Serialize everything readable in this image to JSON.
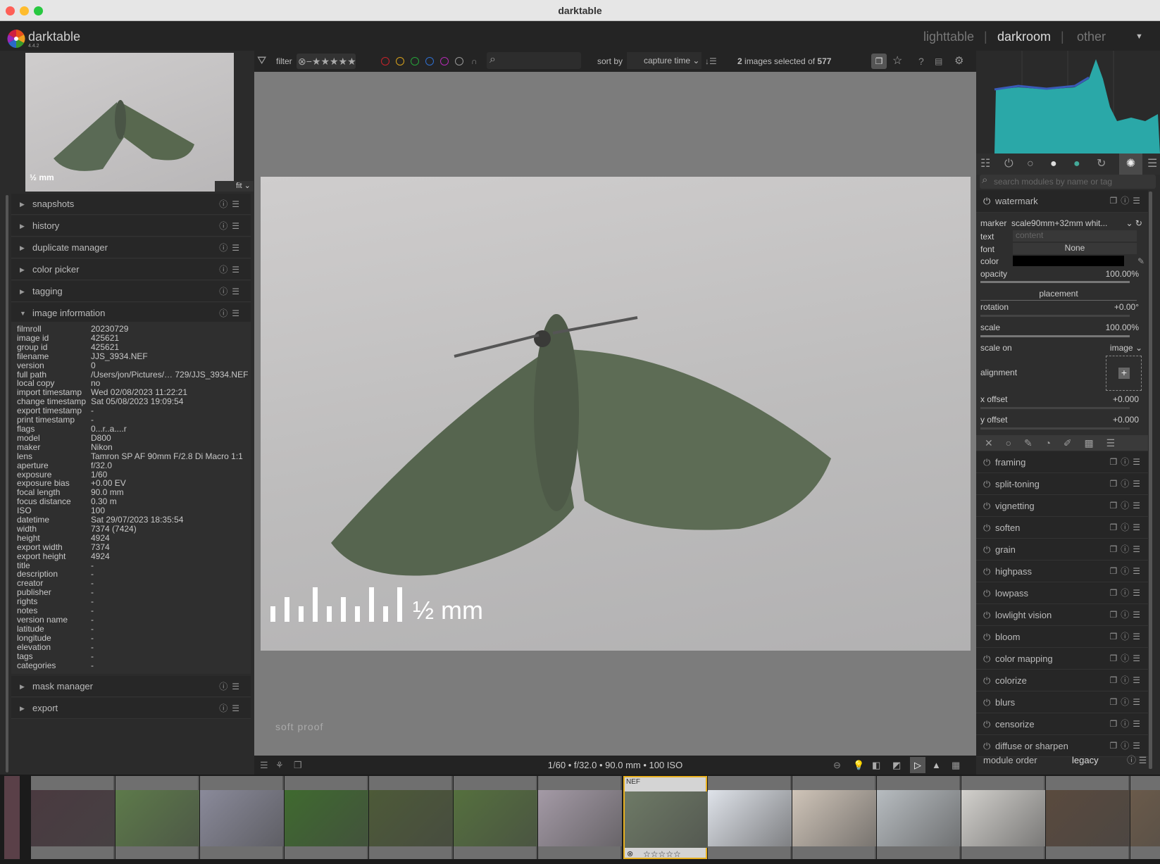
{
  "window": {
    "title": "darktable"
  },
  "app": {
    "name": "darktable",
    "version": "4.4.2"
  },
  "views": {
    "lighttable": "lighttable",
    "darkroom": "darkroom",
    "other": "other",
    "sep": "|",
    "active": "darkroom"
  },
  "filterbar": {
    "filter_label": "filter",
    "search_placeholder": "",
    "sort_label": "sort by",
    "sort_value": "capture time",
    "selected_count": "2",
    "selected_text": " images selected of ",
    "total": "577",
    "color_labels": [
      "#c8232b",
      "#d8a21c",
      "#26a33a",
      "#2f6fd0",
      "#b52bb5",
      "#999999"
    ]
  },
  "thumbnail": {
    "zoom": "fit",
    "watermark": "½ mm"
  },
  "left_modules": [
    {
      "label": "snapshots"
    },
    {
      "label": "history"
    },
    {
      "label": "duplicate manager"
    },
    {
      "label": "color picker"
    },
    {
      "label": "tagging"
    },
    {
      "label": "image information",
      "expanded": true
    }
  ],
  "left_modules_bottom": [
    {
      "label": "mask manager"
    },
    {
      "label": "export"
    }
  ],
  "image_information": [
    [
      "filmroll",
      "20230729"
    ],
    [
      "image id",
      "425621"
    ],
    [
      "group id",
      "425621"
    ],
    [
      "filename",
      "JJS_3934.NEF"
    ],
    [
      "version",
      "0"
    ],
    [
      "full path",
      "/Users/jon/Pictures/… 729/JJS_3934.NEF"
    ],
    [
      "local copy",
      "no"
    ],
    [
      "import timestamp",
      "Wed 02/08/2023 11:22:21"
    ],
    [
      "change timestamp",
      "Sat 05/08/2023 19:09:54"
    ],
    [
      "export timestamp",
      "-"
    ],
    [
      "print timestamp",
      "-"
    ],
    [
      "flags",
      "0...r..a....r"
    ],
    [
      "model",
      "D800"
    ],
    [
      "maker",
      "Nikon"
    ],
    [
      "lens",
      "Tamron SP AF 90mm F/2.8 Di Macro 1:1"
    ],
    [
      "aperture",
      "f/32.0"
    ],
    [
      "exposure",
      "1/60"
    ],
    [
      "exposure bias",
      "+0.00 EV"
    ],
    [
      "focal length",
      "90.0 mm"
    ],
    [
      "focus distance",
      "0.30 m"
    ],
    [
      "ISO",
      "100"
    ],
    [
      "datetime",
      "Sat 29/07/2023 18:35:54"
    ],
    [
      "width",
      "7374 (7424)"
    ],
    [
      "height",
      "4924"
    ],
    [
      "export width",
      "7374"
    ],
    [
      "export height",
      "4924"
    ],
    [
      "title",
      "-"
    ],
    [
      "description",
      "-"
    ],
    [
      "creator",
      "-"
    ],
    [
      "publisher",
      "-"
    ],
    [
      "rights",
      "-"
    ],
    [
      "notes",
      "-"
    ],
    [
      "version name",
      "-"
    ],
    [
      "latitude",
      "-"
    ],
    [
      "longitude",
      "-"
    ],
    [
      "elevation",
      "-"
    ],
    [
      "tags",
      "-"
    ],
    [
      "categories",
      "-"
    ]
  ],
  "main_image": {
    "watermark": "½ mm",
    "soft_proof": "soft proof"
  },
  "bottombar": {
    "exif": "1/60 • f/32.0 • 90.0 mm • 100 ISO"
  },
  "right_panel": {
    "search_placeholder": "search modules by name or tag",
    "watermark": {
      "title": "watermark",
      "marker_label": "marker",
      "marker_value": "scale90mm+32mm whit...",
      "text_label": "text",
      "text_placeholder": "content",
      "font_label": "font",
      "font_value": "None",
      "color_label": "color",
      "color_value": "#000000",
      "opacity_label": "opacity",
      "opacity_value": "100.00%",
      "opacity": 100,
      "placement": "placement",
      "rotation_label": "rotation",
      "rotation_value": "+0.00°",
      "scale_label": "scale",
      "scale_value": "100.00%",
      "scale": 100,
      "scale_on_label": "scale on",
      "scale_on_value": "image",
      "alignment_label": "alignment",
      "alignment": "center",
      "x_offset_label": "x offset",
      "x_offset_value": "+0.000",
      "y_offset_label": "y offset",
      "y_offset_value": "+0.000"
    },
    "modules": [
      "framing",
      "split-toning",
      "vignetting",
      "soften",
      "grain",
      "highpass",
      "lowpass",
      "lowlight vision",
      "bloom",
      "color mapping",
      "colorize",
      "blurs",
      "censorize",
      "diffuse or sharpen"
    ],
    "module_order_label": "module order",
    "module_order_value": "legacy"
  },
  "filmstrip": {
    "selected_format": "NEF",
    "selected_rating": "☆☆☆☆☆",
    "selected_index": 7,
    "thumb_colors": [
      "#4a3a40",
      "#5d7a4a",
      "#8a8a9a",
      "#3f6a2f",
      "#4d5a38",
      "#55703e",
      "#a49aa6",
      "#6e7a66",
      "#dfe3ea",
      "#cfc4b8",
      "#b7bcc0",
      "#d2d0cc",
      "#5a4a3e",
      "#6a5a4a"
    ]
  }
}
